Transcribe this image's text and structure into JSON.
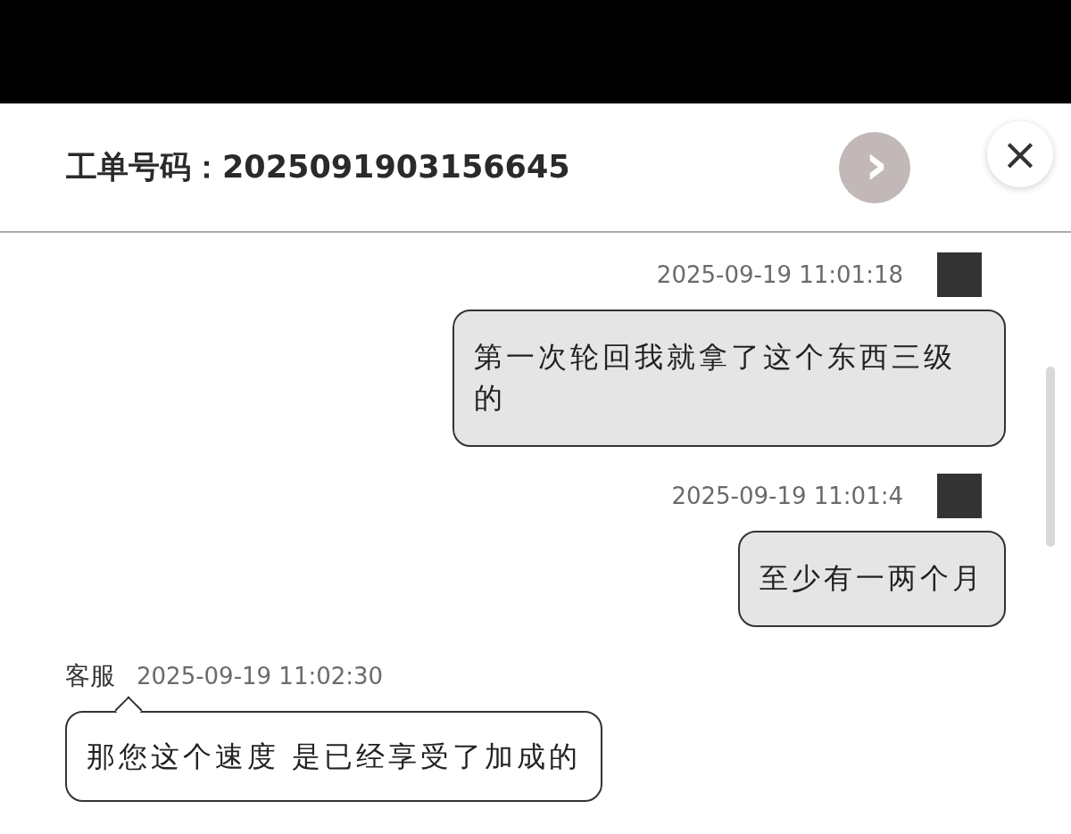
{
  "header": {
    "title": "工单号码：2025091903156645",
    "next_label": "›",
    "close_label": "×"
  },
  "messages": [
    {
      "kind": "user",
      "time": "2025-09-19 11:01:18",
      "text": "第一次轮回我就拿了这个东西三级的"
    },
    {
      "kind": "user",
      "time": "2025-09-19 11:01:4",
      "text": "至少有一两个月"
    },
    {
      "kind": "agent",
      "sender": "客服",
      "time": "2025-09-19 11:02:30",
      "text": "那您这个速度 是已经享受了加成的"
    }
  ]
}
